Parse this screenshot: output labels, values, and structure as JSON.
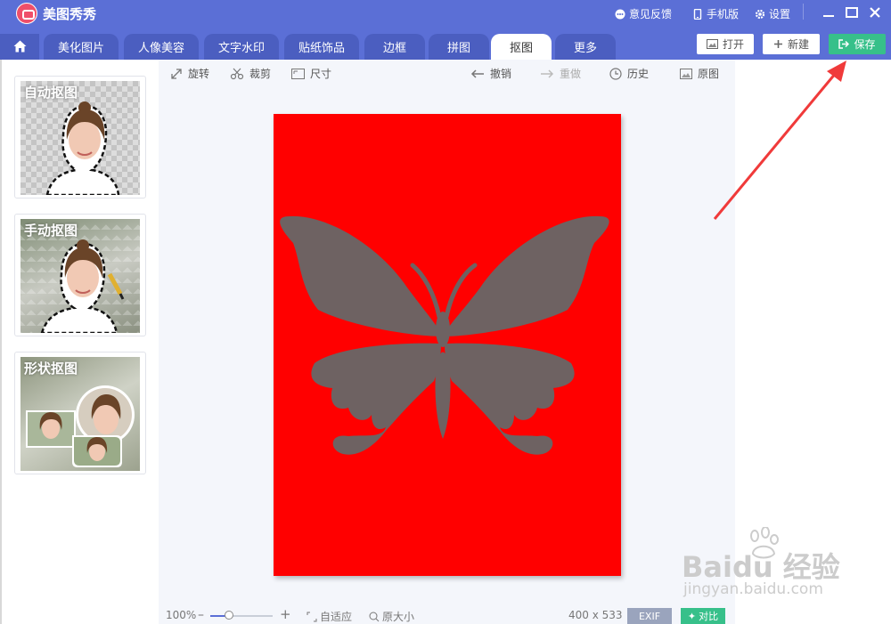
{
  "app": {
    "title": "美图秀秀"
  },
  "titlebar": {
    "feedback": "意见反馈",
    "mobile": "手机版",
    "settings": "设置"
  },
  "tabs": [
    {
      "label": "美化图片"
    },
    {
      "label": "人像美容"
    },
    {
      "label": "文字水印"
    },
    {
      "label": "贴纸饰品"
    },
    {
      "label": "边框"
    },
    {
      "label": "拼图"
    },
    {
      "label": "抠图"
    },
    {
      "label": "更多"
    }
  ],
  "actions": {
    "open": "打开",
    "new": "新建",
    "save": "保存"
  },
  "cutout_modes": [
    {
      "label": "自动抠图"
    },
    {
      "label": "手动抠图"
    },
    {
      "label": "形状抠图"
    }
  ],
  "toolbar": {
    "rotate": "旋转",
    "crop": "裁剪",
    "size": "尺寸",
    "undo": "撤销",
    "redo": "重做",
    "history": "历史",
    "original": "原图"
  },
  "status": {
    "zoom": "100%",
    "fit": "自适应",
    "actual": "原大小",
    "dimensions": "400 x 533",
    "exif": "EXIF",
    "compare": "对比"
  },
  "watermark": {
    "line1": "Baidu 经验",
    "line2": "jingyan.baidu.com"
  },
  "colors": {
    "brand": "#5b6fd6",
    "save": "#37c08a",
    "canvas": "#ff0000",
    "butterfly": "#6e6262",
    "arrow": "#f03a3a"
  }
}
